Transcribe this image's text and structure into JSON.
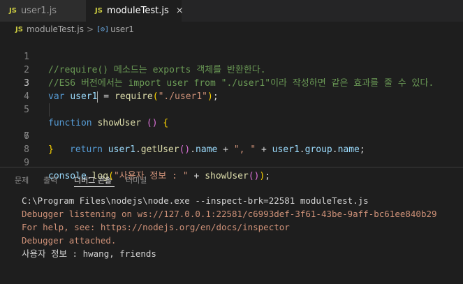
{
  "tabs": [
    {
      "icon": "JS",
      "label": "user1.js",
      "active": false
    },
    {
      "icon": "JS",
      "label": "moduleTest.js",
      "active": true,
      "close": "×"
    }
  ],
  "breadcrumb": {
    "icon": "JS",
    "file": "moduleTest.js",
    "separator": ">",
    "symbol_icon": "[⊙]",
    "symbol": "user1"
  },
  "editor": {
    "line_numbers": [
      "1",
      "2",
      "3",
      "4",
      "5",
      "6",
      "7",
      "8",
      "9"
    ],
    "active_line": 3,
    "lines": {
      "l1": "//require() 메소드는 exports 객체를 반환한다.",
      "l2": "//ES6 버전에서는 import user from \"./user1\"이라 작성하면 같은 효과를 줄 수 있다.",
      "l3": {
        "kw": "var",
        "a": "user1",
        "b": " = ",
        "fn": "require",
        "p1": "(",
        "str": "\"./user1\"",
        "p2": ")",
        "semi": ";"
      },
      "l5": {
        "kw": "function",
        "fn": "showUser",
        "p": " () ",
        "b": "{"
      },
      "l6": {
        "kw": "return",
        "v1": "user1",
        "d1": ".",
        "fn": "getUser",
        "p": "()",
        "d2": ".",
        "v2": "name",
        "op1": " + ",
        "str": "\", \"",
        "op2": " + ",
        "v3": "user1",
        "d3": ".",
        "v4": "group",
        "d4": ".",
        "v5": "name",
        "semi": ";"
      },
      "l7": {
        "b": "}"
      },
      "l9": {
        "v": "console",
        "d": ".",
        "fn": "log",
        "p1": "(",
        "str": "\"사용자 정보 : \"",
        "op": " + ",
        "fn2": "showUser",
        "p2": "()",
        "p3": ")",
        "semi": ";"
      }
    }
  },
  "panel": {
    "tabs": [
      "문제",
      "출력",
      "디버그 콘솔",
      "터미널"
    ],
    "active_tab": "디버그 콘솔",
    "console": [
      {
        "kind": "out",
        "text": "C:\\Program Files\\nodejs\\node.exe --inspect-brk=22581 moduleTest.js"
      },
      {
        "kind": "cmd",
        "text": "Debugger listening on ws://127.0.0.1:22581/c6993def-3f61-43be-9aff-bc61ee840b29"
      },
      {
        "kind": "cmd",
        "text": "For help, see: https://nodejs.org/en/docs/inspector"
      },
      {
        "kind": "cmd",
        "text": "Debugger attached."
      },
      {
        "kind": "out",
        "text": "사용자 정보 : hwang, friends"
      }
    ]
  },
  "colors": {
    "background": "#1e1e1e",
    "tabbar": "#252526",
    "comment": "#6a9955",
    "keyword": "#569cd6",
    "string": "#ce9178",
    "function": "#dcdcaa",
    "variable": "#9cdcfe"
  }
}
